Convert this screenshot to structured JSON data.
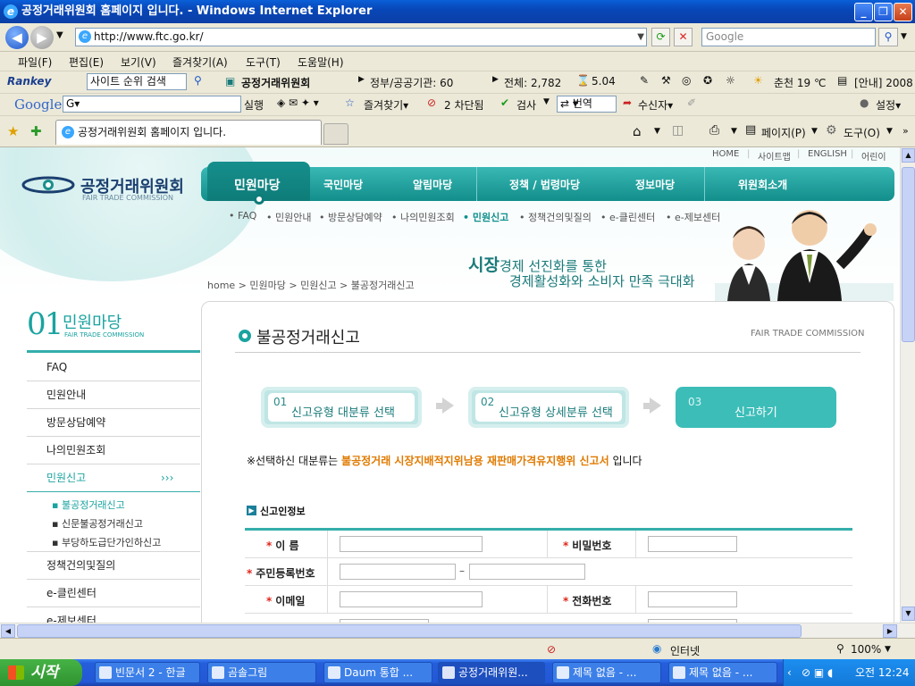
{
  "window": {
    "title": "공정거래위원회 홈페이지 입니다. - Windows Internet Explorer"
  },
  "address": {
    "url": "http://www.ftc.go.kr/",
    "search_placeholder": "Google"
  },
  "menu": [
    "파일(F)",
    "편집(E)",
    "보기(V)",
    "즐겨찾기(A)",
    "도구(T)",
    "도움말(H)"
  ],
  "rankey_bar": {
    "brand": "Rankey",
    "search_value": "사이트 순위 검색",
    "site_name": "공정거래위원회",
    "category": "정부/공공기관: 60",
    "total": "전체: 2,782",
    "score": "5.04",
    "weather": "춘천 19 ℃",
    "notice": "[안내] 2008"
  },
  "google_bar": {
    "brand": "Google",
    "run": "실행",
    "bookmarks": "즐겨찾기▾",
    "blocked": "2 차단됨",
    "check": "검사",
    "translate": "번역",
    "sendto": "수신자▾",
    "settings": "설정▾"
  },
  "tabs": {
    "active": "공정거래위원회 홈페이지 입니다.",
    "page": "페이지(P)",
    "tools": "도구(O)"
  },
  "site": {
    "util_links": [
      "HOME",
      "사이트맵",
      "ENGLISH",
      "어린이"
    ],
    "logo_text": "공정거래위원회",
    "logo_sub": "FAIR TRADE COMMISSION",
    "gnb": [
      "민원마당",
      "국민마당",
      "알림마당",
      "정책 / 법령마당",
      "정보마당",
      "위원회소개"
    ],
    "subnav": [
      "FAQ",
      "민원안내",
      "방문상담예약",
      "나의민원조회",
      "민원신고",
      "정책건의및질의",
      "e-클린센터",
      "e-제보센터"
    ],
    "breadcrumb": "home > 민원마당 > 민원신고 > 불공정거래신고",
    "slogan_big": "시장",
    "slogan_rest": "경제 선진화를 통한",
    "slogan_line2": "경제활성화와 소비자 만족 극대화",
    "lnb_num": "01",
    "lnb_title": "민원마당",
    "lnb_sub": "FAIR TRADE COMMISSION",
    "lnb_items": [
      "FAQ",
      "민원안내",
      "방문상담예약",
      "나의민원조회",
      "민원신고",
      "정책건의및질의",
      "e-클린센터",
      "e-제보센터"
    ],
    "lnb_more": "›››",
    "lnb_subitems": [
      "불공정거래신고",
      "신문불공정거래신고",
      "부당하도급단가인하신고"
    ],
    "page_title": "불공정거래신고",
    "page_tag": "FAIR TRADE COMMISSION",
    "steps": [
      {
        "num": "01",
        "label": "신고유형 대분류 선택"
      },
      {
        "num": "02",
        "label": "신고유형 상세분류 선택"
      },
      {
        "num": "03",
        "label": "신고하기"
      }
    ],
    "selection_prefix": "※선택하신 대분류는",
    "selection_value": "불공정거래 시장지배적지위남용 재판매가격유지행위 신고서",
    "selection_suffix": "입니다",
    "section_title": "신고인정보",
    "fields": {
      "name": "이 름",
      "password": "비밀번호",
      "rrn": "주민등록번호",
      "email": "이메일",
      "phone": "전화번호"
    }
  },
  "status": {
    "zone": "인터넷",
    "zoom": "100%"
  },
  "taskbar": {
    "start": "시작",
    "items": [
      "빈문서 2 - 한글",
      "곰솔그림",
      "Daum 통합 ...",
      "공정거래위원...",
      "제목 없음 - ...",
      "제목 없음 - ..."
    ],
    "clock": "오전 12:24"
  }
}
